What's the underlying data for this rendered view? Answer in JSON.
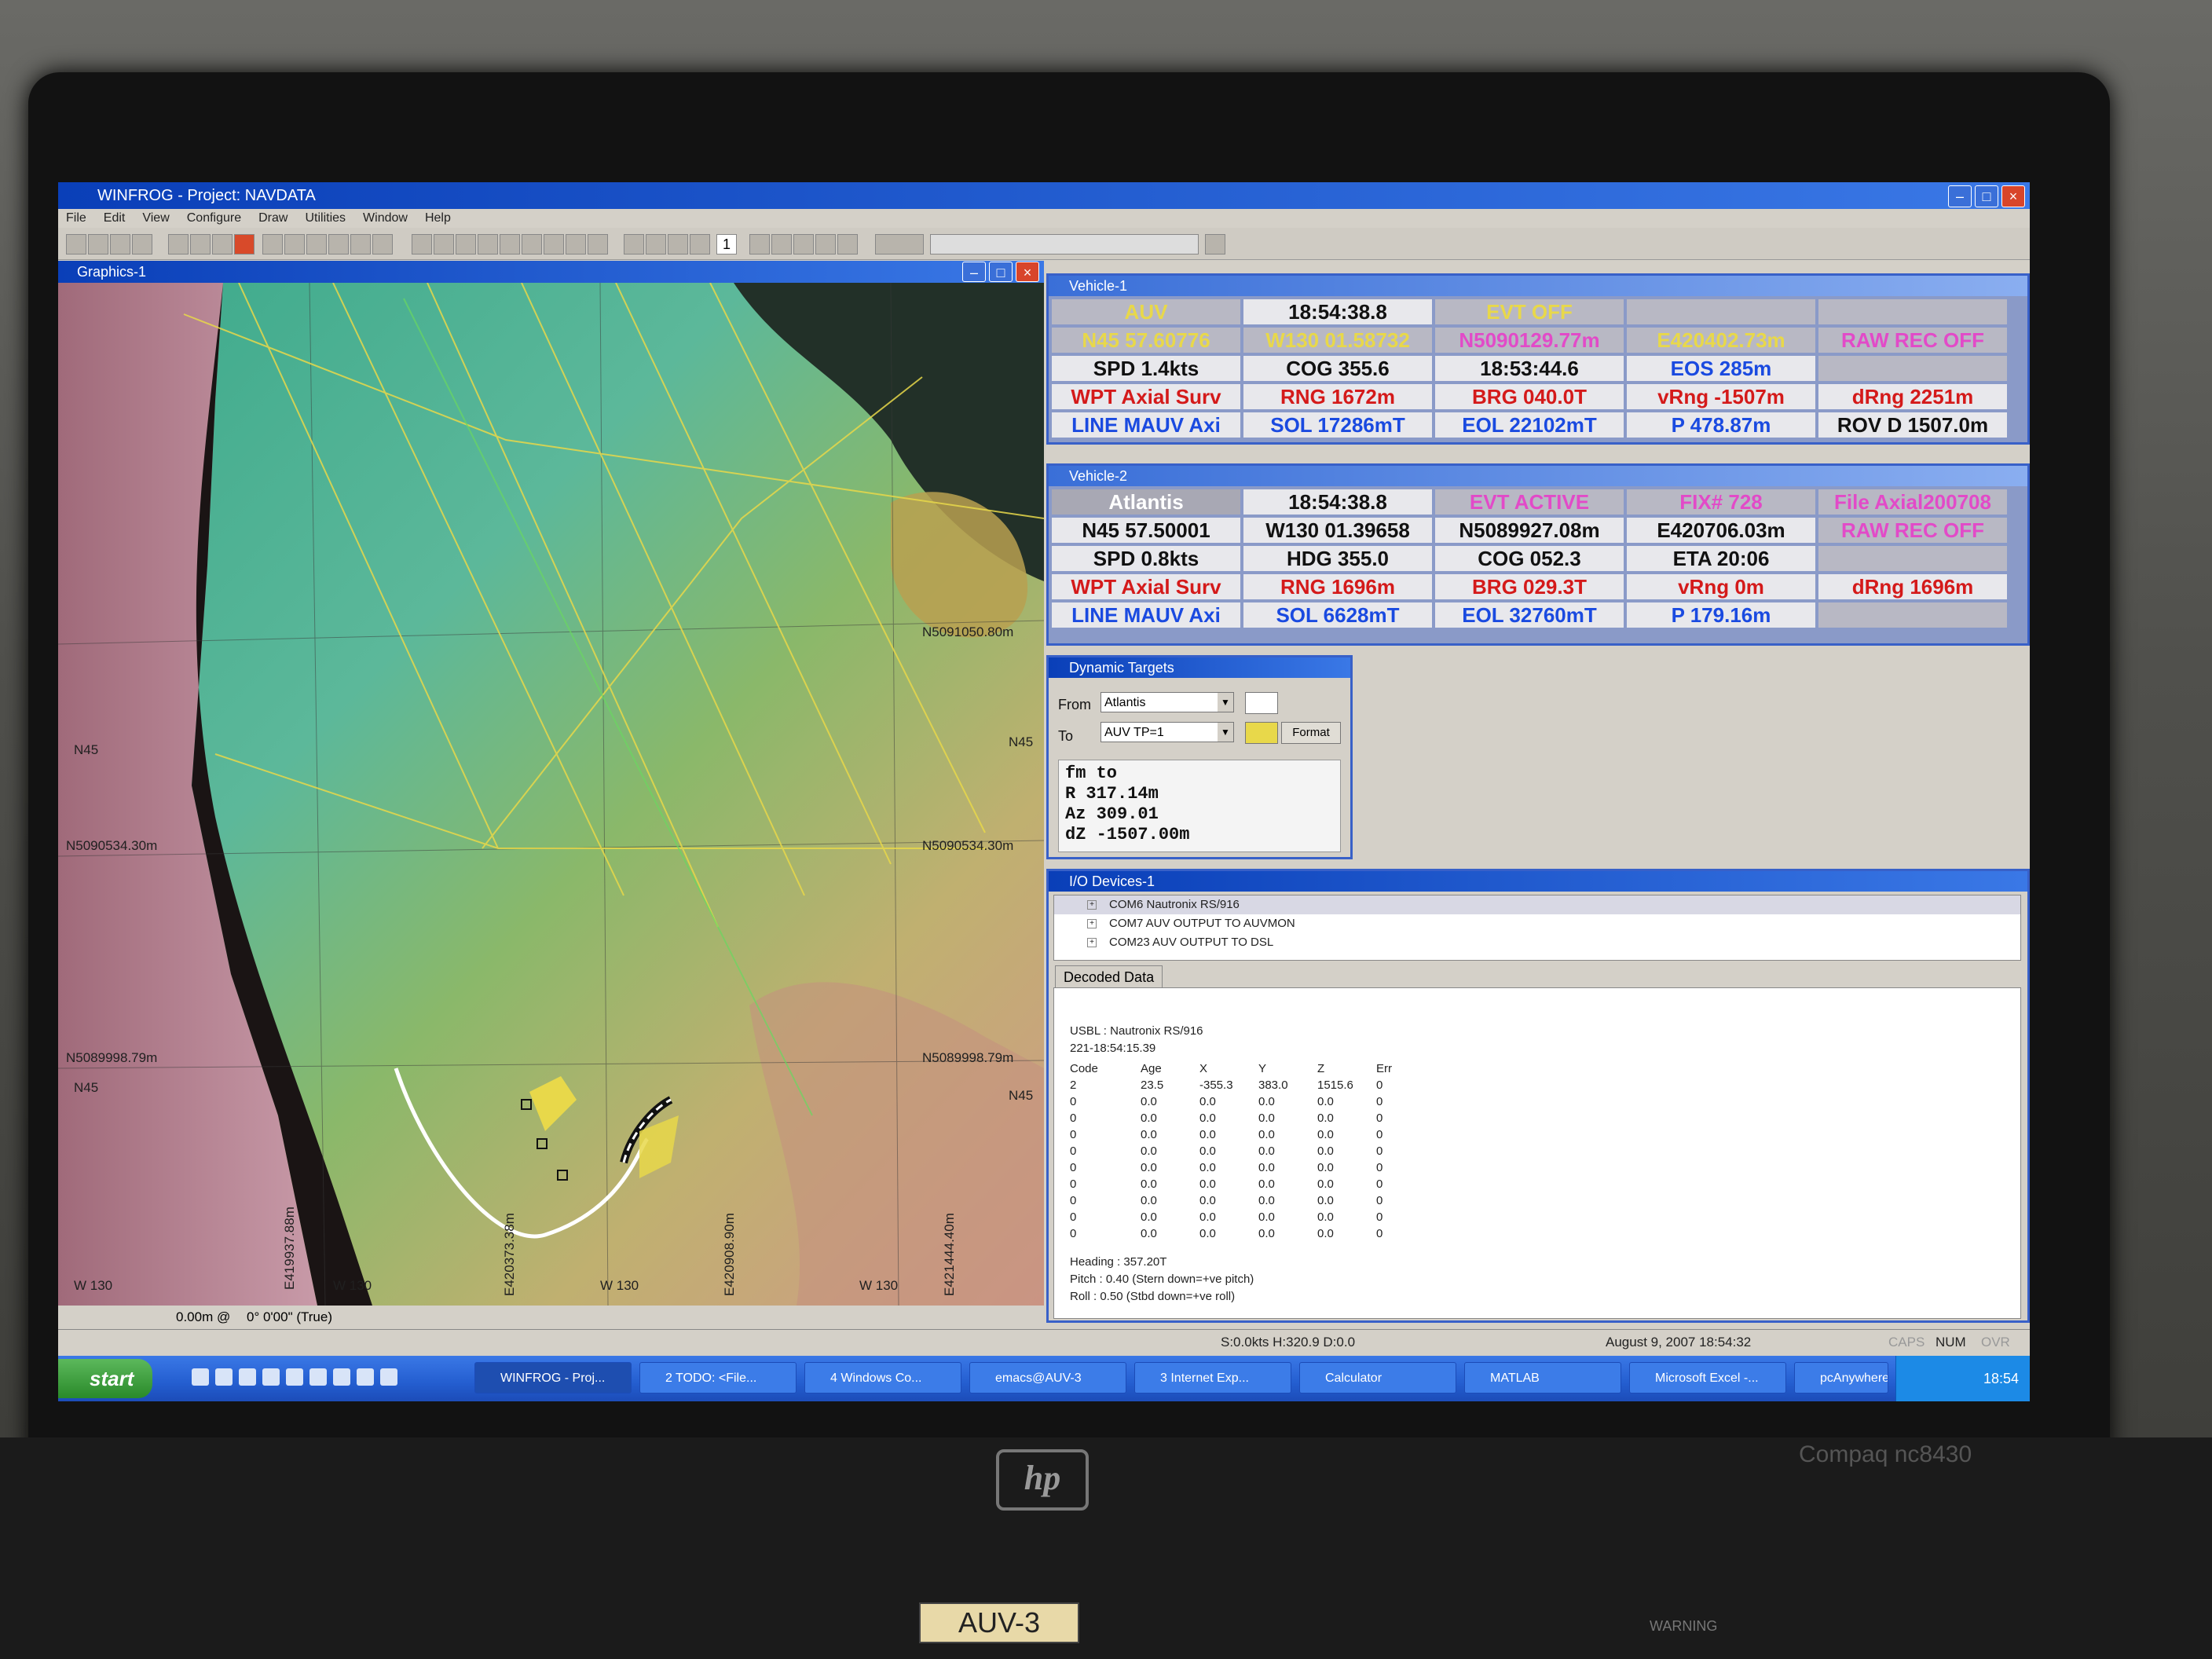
{
  "app": {
    "title": "WINFROG - Project: NAVDATA",
    "menus": [
      "File",
      "Edit",
      "View",
      "Configure",
      "Draw",
      "Utilities",
      "Window",
      "Help"
    ],
    "toolbar_page": "1"
  },
  "graphics": {
    "title": "Graphics-1",
    "labels": {
      "n5091": "N5091050.80m",
      "n5090534_r": "N5090534.30m",
      "n5090534_l": "N5090534.30m",
      "n5089998_r": "N5089998.79m",
      "n5089998_l": "N5089998.79m",
      "n45_l": "N45",
      "n45_r": "N45",
      "n45_r2": "N45",
      "n45_l2": "N45",
      "w130_a": "W 130",
      "w130_b": "W 130",
      "w130_c": "W 130",
      "w130_d": "W 130",
      "e419937": "E419937.88m",
      "e420373": "E420373.38m",
      "e420908": "E420908.90m",
      "e421444": "E421444.40m"
    },
    "status_left": "0.00m @",
    "status_mid": "0° 0'00\" (True)"
  },
  "vehicle1": {
    "title": "Vehicle-1",
    "rows": [
      [
        "AUV",
        "18:54:38.8",
        "EVT OFF",
        "",
        ""
      ],
      [
        "N45 57.60776",
        "W130 01.58732",
        "N5090129.77m",
        "E420402.73m",
        "RAW REC OFF"
      ],
      [
        "SPD 1.4kts",
        "COG 355.6",
        "18:53:44.6",
        "EOS 285m",
        ""
      ],
      [
        "WPT Axial Surv",
        "RNG 1672m",
        "BRG 040.0T",
        "vRng -1507m",
        "dRng 2251m"
      ],
      [
        "LINE MAUV Axi",
        "SOL 17286mT",
        "EOL 22102mT",
        "P 478.87m",
        "ROV D 1507.0m"
      ]
    ]
  },
  "vehicle2": {
    "title": "Vehicle-2",
    "rows": [
      [
        "Atlantis",
        "18:54:38.8",
        "EVT ACTIVE",
        "FIX# 728",
        "File Axial200708"
      ],
      [
        "N45 57.50001",
        "W130 01.39658",
        "N5089927.08m",
        "E420706.03m",
        "RAW REC OFF"
      ],
      [
        "SPD 0.8kts",
        "HDG 355.0",
        "COG 052.3",
        "ETA 20:06",
        ""
      ],
      [
        "WPT Axial Surv",
        "RNG 1696m",
        "BRG 029.3T",
        "vRng 0m",
        "dRng 1696m"
      ],
      [
        "LINE MAUV Axi",
        "SOL 6628mT",
        "EOL 32760mT",
        "P 179.16m",
        ""
      ]
    ]
  },
  "dynamic_targets": {
    "title": "Dynamic Targets",
    "from_label": "From",
    "from_value": "Atlantis",
    "to_label": "To",
    "to_value": "AUV TP=1",
    "format_button": "Format",
    "output": [
      "fm  to",
      "R  317.14m",
      "Az 309.01",
      "dZ -1507.00m"
    ]
  },
  "io_devices": {
    "title": "I/O Devices-1",
    "devices": [
      "COM6 Nautronix RS/916",
      "COM7 AUV OUTPUT TO AUVMON",
      "COM23 AUV OUTPUT TO DSL"
    ],
    "tab": "Decoded Data",
    "decoded_header": "USBL : Nautronix RS/916",
    "decoded_time": "221-18:54:15.39",
    "columns": [
      "Code",
      "Age",
      "X",
      "Y",
      "Z",
      "Err"
    ],
    "rows": [
      [
        "2",
        "23.5",
        "-355.3",
        "383.0",
        "1515.6",
        "0"
      ],
      [
        "0",
        "0.0",
        "0.0",
        "0.0",
        "0.0",
        "0"
      ],
      [
        "0",
        "0.0",
        "0.0",
        "0.0",
        "0.0",
        "0"
      ],
      [
        "0",
        "0.0",
        "0.0",
        "0.0",
        "0.0",
        "0"
      ],
      [
        "0",
        "0.0",
        "0.0",
        "0.0",
        "0.0",
        "0"
      ],
      [
        "0",
        "0.0",
        "0.0",
        "0.0",
        "0.0",
        "0"
      ],
      [
        "0",
        "0.0",
        "0.0",
        "0.0",
        "0.0",
        "0"
      ],
      [
        "0",
        "0.0",
        "0.0",
        "0.0",
        "0.0",
        "0"
      ],
      [
        "0",
        "0.0",
        "0.0",
        "0.0",
        "0.0",
        "0"
      ],
      [
        "0",
        "0.0",
        "0.0",
        "0.0",
        "0.0",
        "0"
      ]
    ],
    "heading": "Heading : 357.20T",
    "pitch": "Pitch    : 0.40 (Stern down=+ve pitch)",
    "roll": "Roll     : 0.50 (Stbd down=+ve roll)"
  },
  "status_bar": {
    "speed": "S:0.0kts H:320.9 D:0.0",
    "date": "August 9, 2007 18:54:32",
    "caps": "CAPS",
    "num": "NUM",
    "ovr": "OVR"
  },
  "taskbar": {
    "start": "start",
    "tasks": [
      "WINFROG - Proj...",
      "2 TODO: <File...",
      "4 Windows Co...",
      "emacs@AUV-3",
      "3 Internet Exp...",
      "Calculator",
      "MATLAB",
      "Microsoft Excel -...",
      "pcAnywhere Ma..."
    ],
    "clock": "18:54"
  },
  "hardware": {
    "brand": "hp",
    "model": "Compaq nc8430",
    "tag": "AUV-3",
    "warning": "WARNING"
  },
  "colors": {
    "titlebar": "#0a3fb8",
    "pane_bg": "#8a9ac8",
    "red": "#d41a1a",
    "blue": "#1a4ae0",
    "magenta": "#e24ac8"
  }
}
